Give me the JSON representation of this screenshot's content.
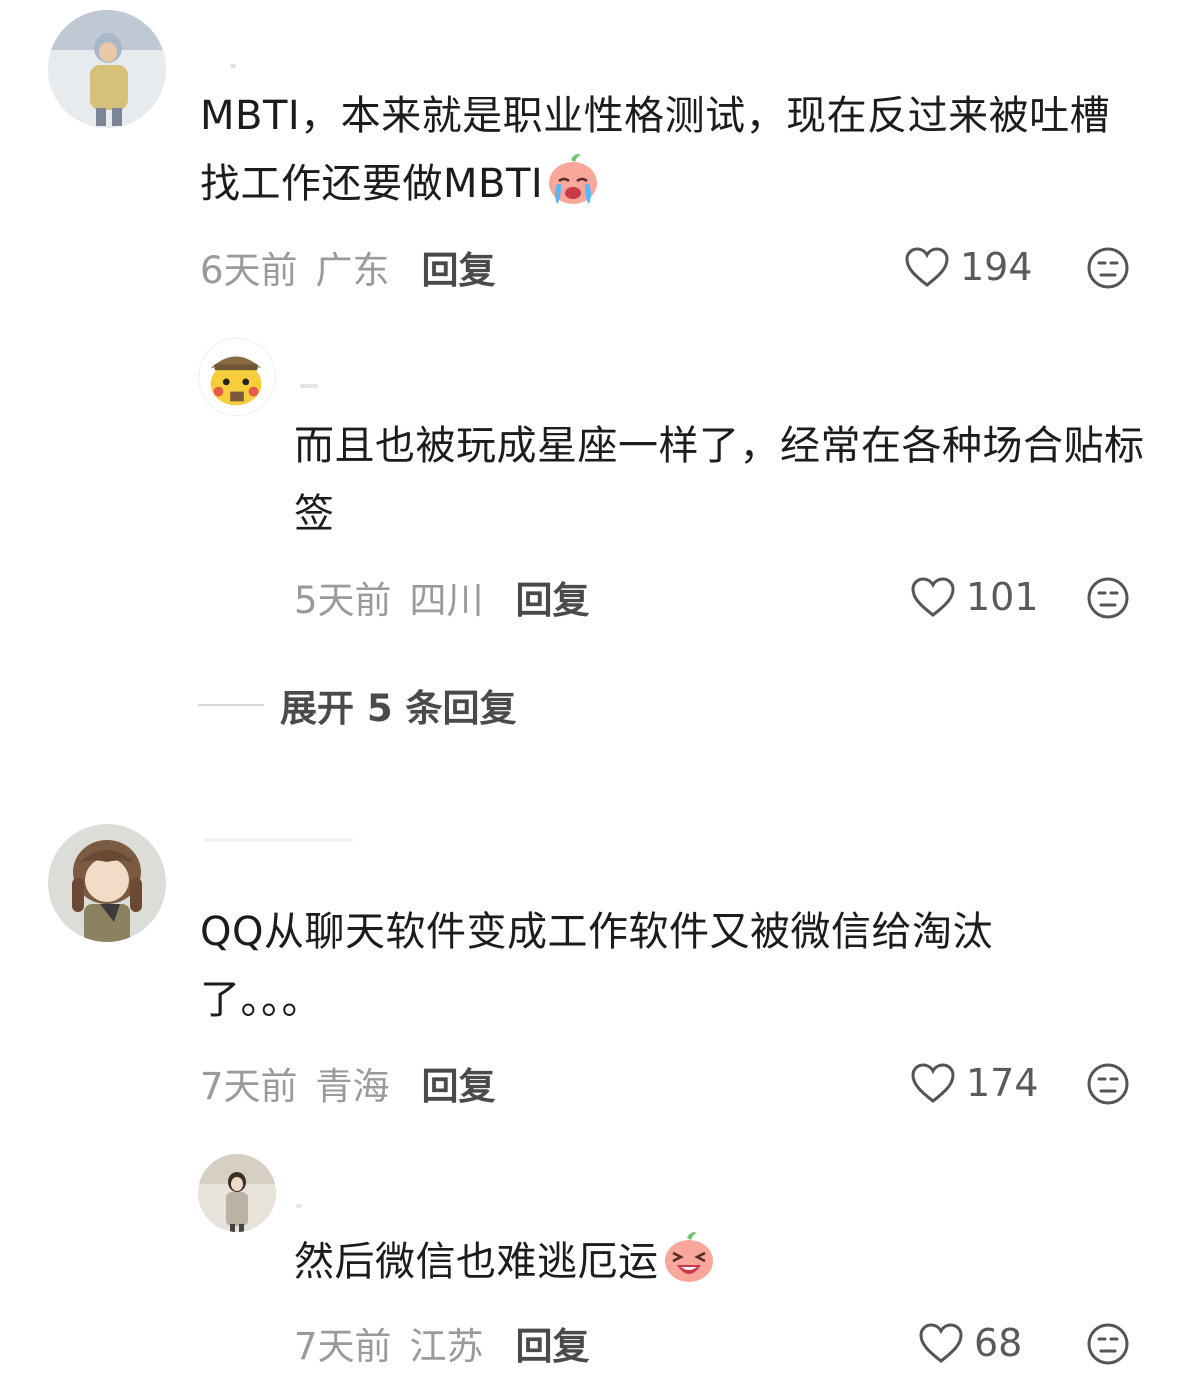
{
  "comments": [
    {
      "text": "MBTI，本来就是职业性格测试，现在反过来被吐槽找工作还要做MBTI",
      "emoji": "crying-peach-emoji",
      "time": "6天前",
      "region": "广东",
      "reply_label": "回复",
      "likes": "194",
      "replies": [
        {
          "text": "而且也被玩成星座一样了，经常在各种场合贴标签",
          "time": "5天前",
          "region": "四川",
          "reply_label": "回复",
          "likes": "101"
        }
      ],
      "expand_label": "展开 5 条回复"
    },
    {
      "text": "QQ从聊天软件变成工作软件又被微信给淘汰了。。。",
      "time": "7天前",
      "region": "青海",
      "reply_label": "回复",
      "likes": "174",
      "replies": [
        {
          "text": "然后微信也难逃厄运",
          "emoji": "laughing-peach-emoji",
          "time": "7天前",
          "region": "江苏",
          "reply_label": "回复",
          "likes": "68"
        }
      ]
    }
  ],
  "colors": {
    "meta_gray": "#9a9a9a",
    "reply_dark": "#4a4a4a",
    "text": "#1c1c1c",
    "peach": "#f48a7a"
  },
  "icons": [
    "heart-outline-icon",
    "dislike-face-icon"
  ]
}
